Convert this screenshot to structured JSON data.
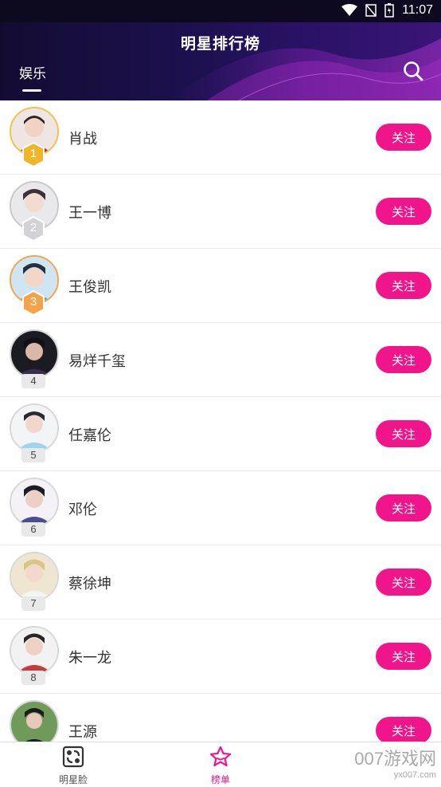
{
  "status_bar": {
    "time": "11:07"
  },
  "header": {
    "title": "明星排行榜",
    "tab_label": "娱乐"
  },
  "list": [
    {
      "rank": "1",
      "name": "肖战",
      "follow": "关注",
      "medal": "gold",
      "color": "#f0c14b"
    },
    {
      "rank": "2",
      "name": "王一博",
      "follow": "关注",
      "medal": "silver",
      "color": "#cfcfcf"
    },
    {
      "rank": "3",
      "name": "王俊凯",
      "follow": "关注",
      "medal": "bronze",
      "color": "#f3a44a"
    },
    {
      "rank": "4",
      "name": "易烊千玺",
      "follow": "关注"
    },
    {
      "rank": "5",
      "name": "任嘉伦",
      "follow": "关注"
    },
    {
      "rank": "6",
      "name": "邓伦",
      "follow": "关注"
    },
    {
      "rank": "7",
      "name": "蔡徐坤",
      "follow": "关注"
    },
    {
      "rank": "8",
      "name": "朱一龙",
      "follow": "关注"
    },
    {
      "rank": "",
      "name": "王源",
      "follow": "关注"
    }
  ],
  "bottom_nav": [
    {
      "label": "明星脸",
      "icon": "face-scan-icon",
      "active": false
    },
    {
      "label": "榜单",
      "icon": "star-icon",
      "active": true
    }
  ],
  "watermark": {
    "main": "007游戏网",
    "sub": "yx007.com"
  },
  "colors": {
    "accent": "#f1158b",
    "header_dark": "#130c32"
  }
}
